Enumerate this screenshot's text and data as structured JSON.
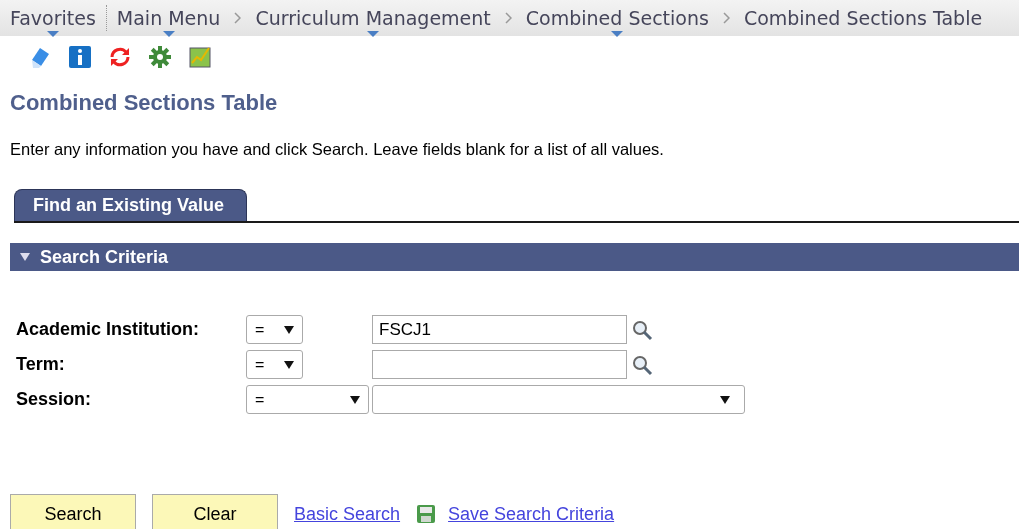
{
  "breadcrumbs": [
    {
      "label": "Favorites",
      "has_menu": true
    },
    {
      "label": "Main Menu",
      "has_menu": true
    },
    {
      "label": "Curriculum Management",
      "has_menu": true
    },
    {
      "label": "Combined Sections",
      "has_menu": true
    },
    {
      "label": "Combined Sections Table",
      "has_menu": false
    }
  ],
  "page": {
    "title": "Combined Sections Table",
    "instructions": "Enter any information you have and click Search. Leave fields blank for a list of all values."
  },
  "tabs": [
    {
      "label": "Find an Existing Value",
      "selected": true
    }
  ],
  "section": {
    "title": "Search Criteria",
    "expanded": true
  },
  "fields": [
    {
      "label": "Academic Institution:",
      "operator": "=",
      "kind": "lookup",
      "value": "FSCJ1"
    },
    {
      "label": "Term:",
      "operator": "=",
      "kind": "lookup"
    },
    {
      "label": "Session:",
      "operator": "=",
      "kind": "dropdown"
    }
  ],
  "buttons": [
    "Search",
    "Clear"
  ],
  "links": [
    {
      "label": "Basic Search",
      "kind": "plain"
    },
    {
      "label": "Save Search Criteria",
      "kind": "save"
    }
  ]
}
